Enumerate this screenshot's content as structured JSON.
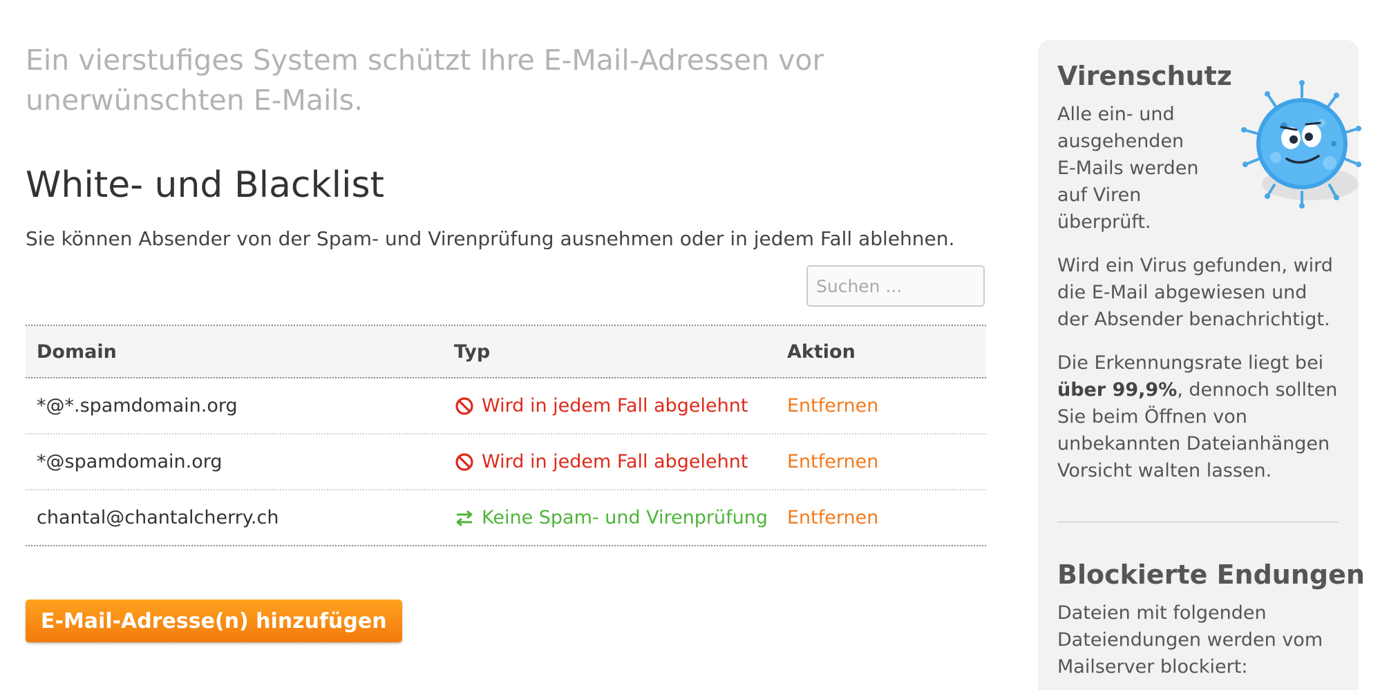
{
  "intro_text": "Ein vierstufiges System schützt Ihre E-Mail-Adressen vor unerwünschten E-Mails.",
  "section": {
    "title": "White- und Blacklist",
    "description": "Sie können Absender von der Spam- und Virenprüfung ausnehmen oder in jedem Fall ablehnen."
  },
  "search": {
    "placeholder": "Suchen ..."
  },
  "table": {
    "headers": {
      "domain": "Domain",
      "typ": "Typ",
      "aktion": "Aktion"
    },
    "rows": [
      {
        "domain": "*@*.spamdomain.org",
        "typ": "Wird in jedem Fall abgelehnt",
        "typ_kind": "block",
        "typ_icon": "block-icon",
        "action": "Entfernen"
      },
      {
        "domain": "*@spamdomain.org",
        "typ": "Wird in jedem Fall abgelehnt",
        "typ_kind": "block",
        "typ_icon": "block-icon",
        "action": "Entfernen"
      },
      {
        "domain": "chantal@chantalcherry.ch",
        "typ": "Keine Spam- und Virenprüfung",
        "typ_kind": "allow",
        "typ_icon": "swap-arrows-icon",
        "action": "Entfernen"
      }
    ]
  },
  "add_button_label": "E-Mail-Adresse(n) hinzufügen",
  "sidebar": {
    "virus_title": "Virenschutz",
    "virus_p1": "Alle ein- und ausgehenden E-Mails werden auf Viren überprüft.",
    "virus_p2": "Wird ein Virus gefunden, wird die E-Mail abgewiesen und der Absender benachrichtigt.",
    "virus_p3_before": "Die Erkennungsrate liegt bei ",
    "virus_p3_bold": "über 99,9%",
    "virus_p3_after": ", dennoch sollten Sie beim Öffnen von unbekannten Dateianhängen Vorsicht walten lassen.",
    "blocked_title": "Blockierte Endungen",
    "blocked_text": "Dateien mit folgenden Dateiendungen werden vom Mailserver blockiert:",
    "mascot_icon": "virus-mascot-icon"
  },
  "colors": {
    "block": "#dd2a1b",
    "allow": "#4fb43a",
    "link": "#f47a1e",
    "button": "#f27a0c",
    "intro": "#b3b3b3"
  }
}
